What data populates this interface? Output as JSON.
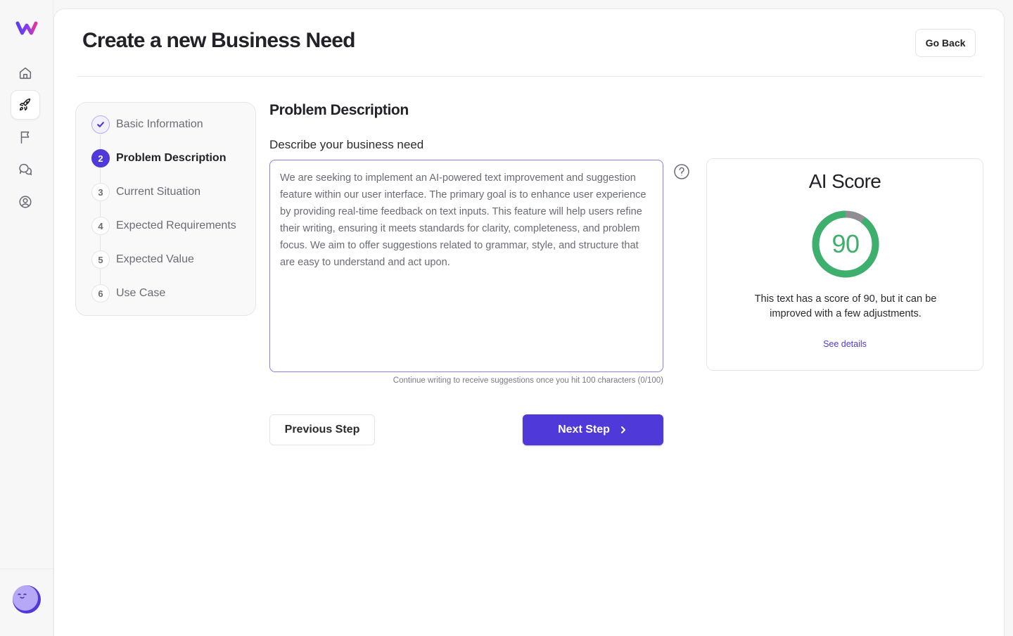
{
  "app": {
    "logo_icon": "w-logo-icon",
    "brand_color": "#4f39d8"
  },
  "sidebar": {
    "items": [
      {
        "icon": "home-icon",
        "active": false
      },
      {
        "icon": "rocket-icon",
        "active": true
      },
      {
        "icon": "flag-icon",
        "active": false
      },
      {
        "icon": "chat-bubbles-icon",
        "active": false
      },
      {
        "icon": "user-circle-icon",
        "active": false
      }
    ],
    "avatar_icon": "avatar-face-icon"
  },
  "header": {
    "title": "Create a new Business Need",
    "go_back_label": "Go Back"
  },
  "stepper": {
    "steps": [
      {
        "number": "",
        "label": "Basic Information",
        "state": "done"
      },
      {
        "number": "2",
        "label": "Problem Description",
        "state": "current"
      },
      {
        "number": "3",
        "label": "Current Situation",
        "state": "upcoming"
      },
      {
        "number": "4",
        "label": "Expected Requirements",
        "state": "upcoming"
      },
      {
        "number": "5",
        "label": "Expected Value",
        "state": "upcoming"
      },
      {
        "number": "6",
        "label": "Use Case",
        "state": "upcoming"
      }
    ]
  },
  "form": {
    "section_title": "Problem Description",
    "field_label": "Describe your business need",
    "textarea_value": "We are seeking to implement an AI-powered text improvement and suggestion feature within our user interface. The primary goal is to enhance user experience by providing real-time feedback on text inputs. This feature will help users refine their writing, ensuring it meets standards for clarity, completeness, and problem focus. We aim to offer suggestions related to grammar, style, and structure that are easy to understand and act upon.",
    "hint": "Continue writing to receive suggestions once you hit 100 characters (0/100)",
    "help_icon": "question-circle-icon"
  },
  "ai_score": {
    "title": "AI Score",
    "value": "90",
    "value_fraction": 0.9,
    "gauge_color": "#3eb06d",
    "track_color": "#8e8e93",
    "description": "This text has a score of 90, but it can be improved with a few adjustments.",
    "details_link": "See details"
  },
  "actions": {
    "previous_label": "Previous Step",
    "next_label": "Next Step",
    "next_icon": "chevron-right-icon"
  }
}
